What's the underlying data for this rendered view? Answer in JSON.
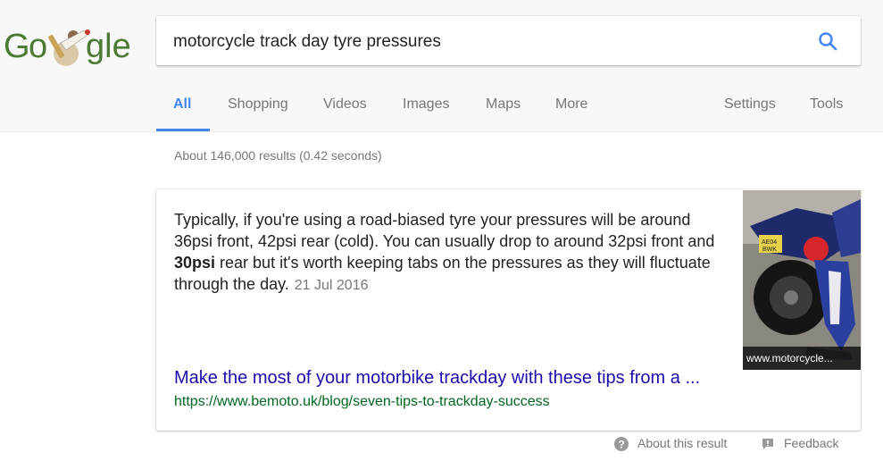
{
  "search": {
    "query": "motorcycle track day tyre pressures"
  },
  "tabs": [
    {
      "label": "All",
      "active": true
    },
    {
      "label": "Shopping"
    },
    {
      "label": "Videos"
    },
    {
      "label": "Images"
    },
    {
      "label": "Maps"
    },
    {
      "label": "More"
    }
  ],
  "tools_tabs": [
    {
      "label": "Settings"
    },
    {
      "label": "Tools"
    }
  ],
  "result_stats": "About 146,000 results (0.42 seconds)",
  "featured_snippet": {
    "text_before_bold": "Typically, if you're using a road-biased tyre your pressures will be around 36psi front, 42psi rear (cold). You can usually drop to around 32psi front and ",
    "bold_text": "30psi",
    "text_after_bold": " rear but it's worth keeping tabs on the pressures as they will fluctuate through the day.",
    "date": "21 Jul 2016",
    "image_caption": "www.motorcycle...",
    "title": "Make the most of your motorbike trackday with these tips from a ...",
    "url": "https://www.bemoto.uk/blog/seven-tips-to-trackday-success"
  },
  "footer": {
    "about_label": "About this result",
    "feedback_label": "Feedback"
  },
  "colors": {
    "accent": "#4285f4",
    "link": "#1a0dab",
    "url": "#006621"
  }
}
